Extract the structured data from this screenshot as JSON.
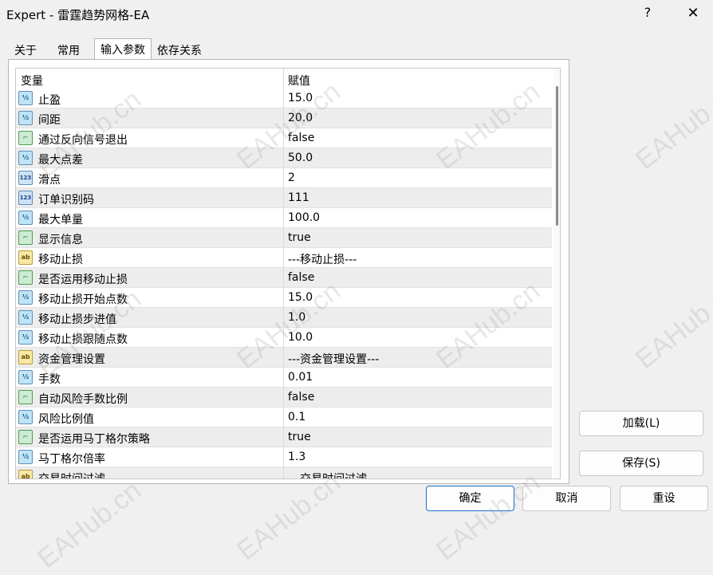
{
  "window": {
    "title": "Expert - 雷霆趋势网格-EA",
    "help_label": "?",
    "close_label": "✕"
  },
  "tabs": [
    {
      "label": "关于"
    },
    {
      "label": "常用"
    },
    {
      "label": "输入参数"
    },
    {
      "label": "依存关系"
    }
  ],
  "grid": {
    "col_variable": "变量",
    "col_value": "赋值",
    "rows": [
      {
        "type": "frac",
        "icon": "½",
        "name": "止盈",
        "value": "15.0"
      },
      {
        "type": "frac",
        "icon": "½",
        "name": "间距",
        "value": "20.0"
      },
      {
        "type": "bool",
        "icon": "⌐",
        "name": "通过反向信号退出",
        "value": "false"
      },
      {
        "type": "frac",
        "icon": "½",
        "name": "最大点差",
        "value": "50.0"
      },
      {
        "type": "int",
        "icon": "123",
        "name": "滑点",
        "value": "2"
      },
      {
        "type": "int",
        "icon": "123",
        "name": "订单识别码",
        "value": "111"
      },
      {
        "type": "frac",
        "icon": "½",
        "name": "最大单量",
        "value": "100.0"
      },
      {
        "type": "bool",
        "icon": "⌐",
        "name": "显示信息",
        "value": "true"
      },
      {
        "type": "str",
        "icon": "ab",
        "name": "移动止损",
        "value": "---移动止损---"
      },
      {
        "type": "bool",
        "icon": "⌐",
        "name": "是否运用移动止损",
        "value": "false"
      },
      {
        "type": "frac",
        "icon": "½",
        "name": "移动止损开始点数",
        "value": "15.0"
      },
      {
        "type": "frac",
        "icon": "½",
        "name": "移动止损步进值",
        "value": "1.0"
      },
      {
        "type": "frac",
        "icon": "½",
        "name": "移动止损跟随点数",
        "value": "10.0"
      },
      {
        "type": "str",
        "icon": "ab",
        "name": "资金管理设置",
        "value": "---资金管理设置---"
      },
      {
        "type": "frac",
        "icon": "½",
        "name": "手数",
        "value": "0.01"
      },
      {
        "type": "bool",
        "icon": "⌐",
        "name": "自动风险手数比例",
        "value": "false"
      },
      {
        "type": "frac",
        "icon": "½",
        "name": "风险比例值",
        "value": "0.1"
      },
      {
        "type": "bool",
        "icon": "⌐",
        "name": "是否运用马丁格尔策略",
        "value": "true"
      },
      {
        "type": "frac",
        "icon": "½",
        "name": "马丁格尔倍率",
        "value": "1.3"
      },
      {
        "type": "str",
        "icon": "ab",
        "name": "交易时间过滤",
        "value": "---交易时间过滤---"
      }
    ]
  },
  "buttons": {
    "load": "加载(L)",
    "save": "保存(S)",
    "ok": "确定",
    "cancel": "取消",
    "reset": "重设"
  },
  "watermark": "EAHub.cn"
}
